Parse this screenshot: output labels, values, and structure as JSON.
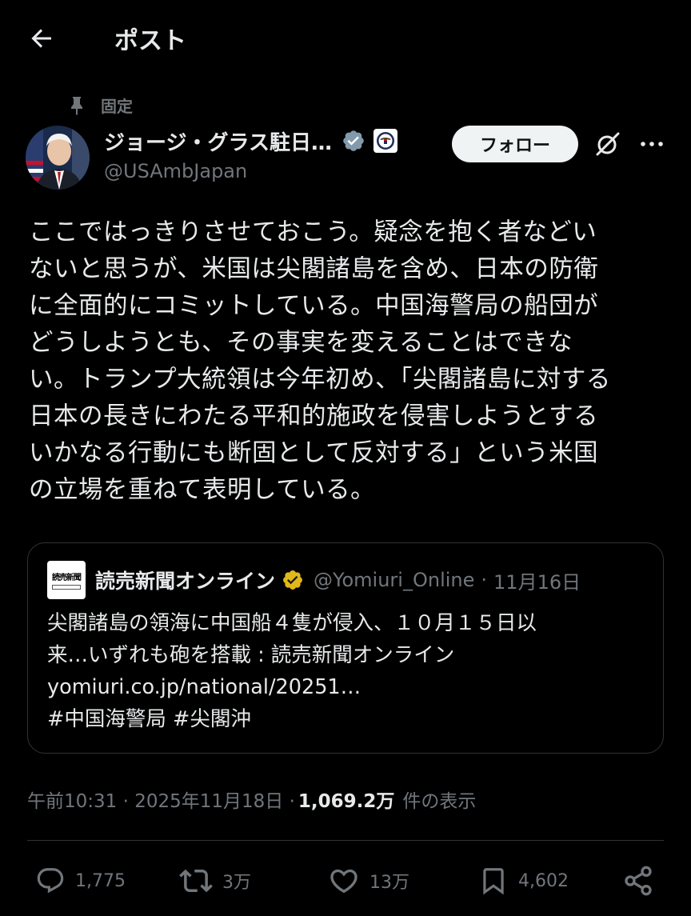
{
  "header": {
    "title": "ポスト"
  },
  "pinned_label": "固定",
  "author": {
    "display_name": "ジョージ・グラス駐日…",
    "handle": "@USAmbJapan"
  },
  "follow_label": "フォロー",
  "post": {
    "lines": [
      "ここではっきりさせておこう。疑念を抱く者などい",
      "ないと思うが、米国は尖閣諸島を含め、日本の防衛",
      "に全面的にコミットしている。中国海警局の船団が",
      "どうしようとも、その事実を変えることはできな",
      "い。トランプ大統領は今年初め、「尖閣諸島に対する",
      "日本の長きにわたる平和的施政を侵害しようとする",
      "いかなる行動にも断固として反対する」という米国",
      "の立場を重ねて表明している。"
    ]
  },
  "quote": {
    "logo_text": "読売新聞",
    "name": "読売新聞オンライン",
    "handle": "@Yomiuri_Online",
    "dot": "·",
    "date": "11月16日",
    "lines": [
      "尖閣諸島の領海に中国船４隻が侵入、１０月１５日以",
      "来…いずれも砲を搭載 : 読売新聞オンライン",
      "yomiuri.co.jp/national/20251…",
      "#中国海警局 #尖閣沖"
    ]
  },
  "meta": {
    "time_date": "午前10:31 · 2025年11月18日 · ",
    "views": "1,069.2万",
    "views_label": "件の表示"
  },
  "actions": {
    "replies": "1,775",
    "reposts": "3万",
    "likes": "13万",
    "bookmarks": "4,602"
  },
  "colors": {
    "background": "#000000",
    "text": "#e7e9ea",
    "muted": "#71767b",
    "verified_blue": "#829aab",
    "verified_gold": "#e2b719",
    "border": "#2f3336"
  },
  "icons": {
    "back": "arrow-left-icon",
    "pin": "pin-icon",
    "grok": "grok-icon",
    "more": "more-icon",
    "reply": "reply-icon",
    "repost": "repost-icon",
    "like": "heart-icon",
    "bookmark": "bookmark-icon",
    "share": "share-icon"
  }
}
